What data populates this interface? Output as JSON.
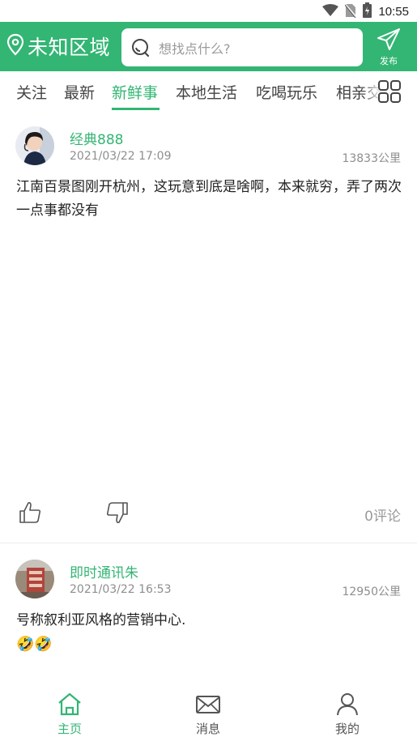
{
  "status_bar": {
    "time": "10:55"
  },
  "header": {
    "location": "未知区域",
    "search_placeholder": "想找点什么?",
    "publish_label": "发布"
  },
  "tabs": [
    "关注",
    "最新",
    "新鲜事",
    "本地生活",
    "吃喝玩乐",
    "相亲交友"
  ],
  "active_tab": "新鲜事",
  "posts": [
    {
      "username": "经典888",
      "time": "2021/03/22 17:09",
      "distance": "13833公里",
      "content": "江南百景图刚开杭州，这玩意到底是啥啊，本来就穷，弄了两次一点事都没有",
      "comments": "0评论"
    },
    {
      "username": "即时通讯朱",
      "time": "2021/03/22 16:53",
      "distance": "12950公里",
      "content": "号称叙利亚风格的营销中心.",
      "emoji": "🤣🤣"
    }
  ],
  "bottom_nav": {
    "home": "主页",
    "messages": "消息",
    "mine": "我的"
  },
  "colors": {
    "accent": "#33b574"
  }
}
